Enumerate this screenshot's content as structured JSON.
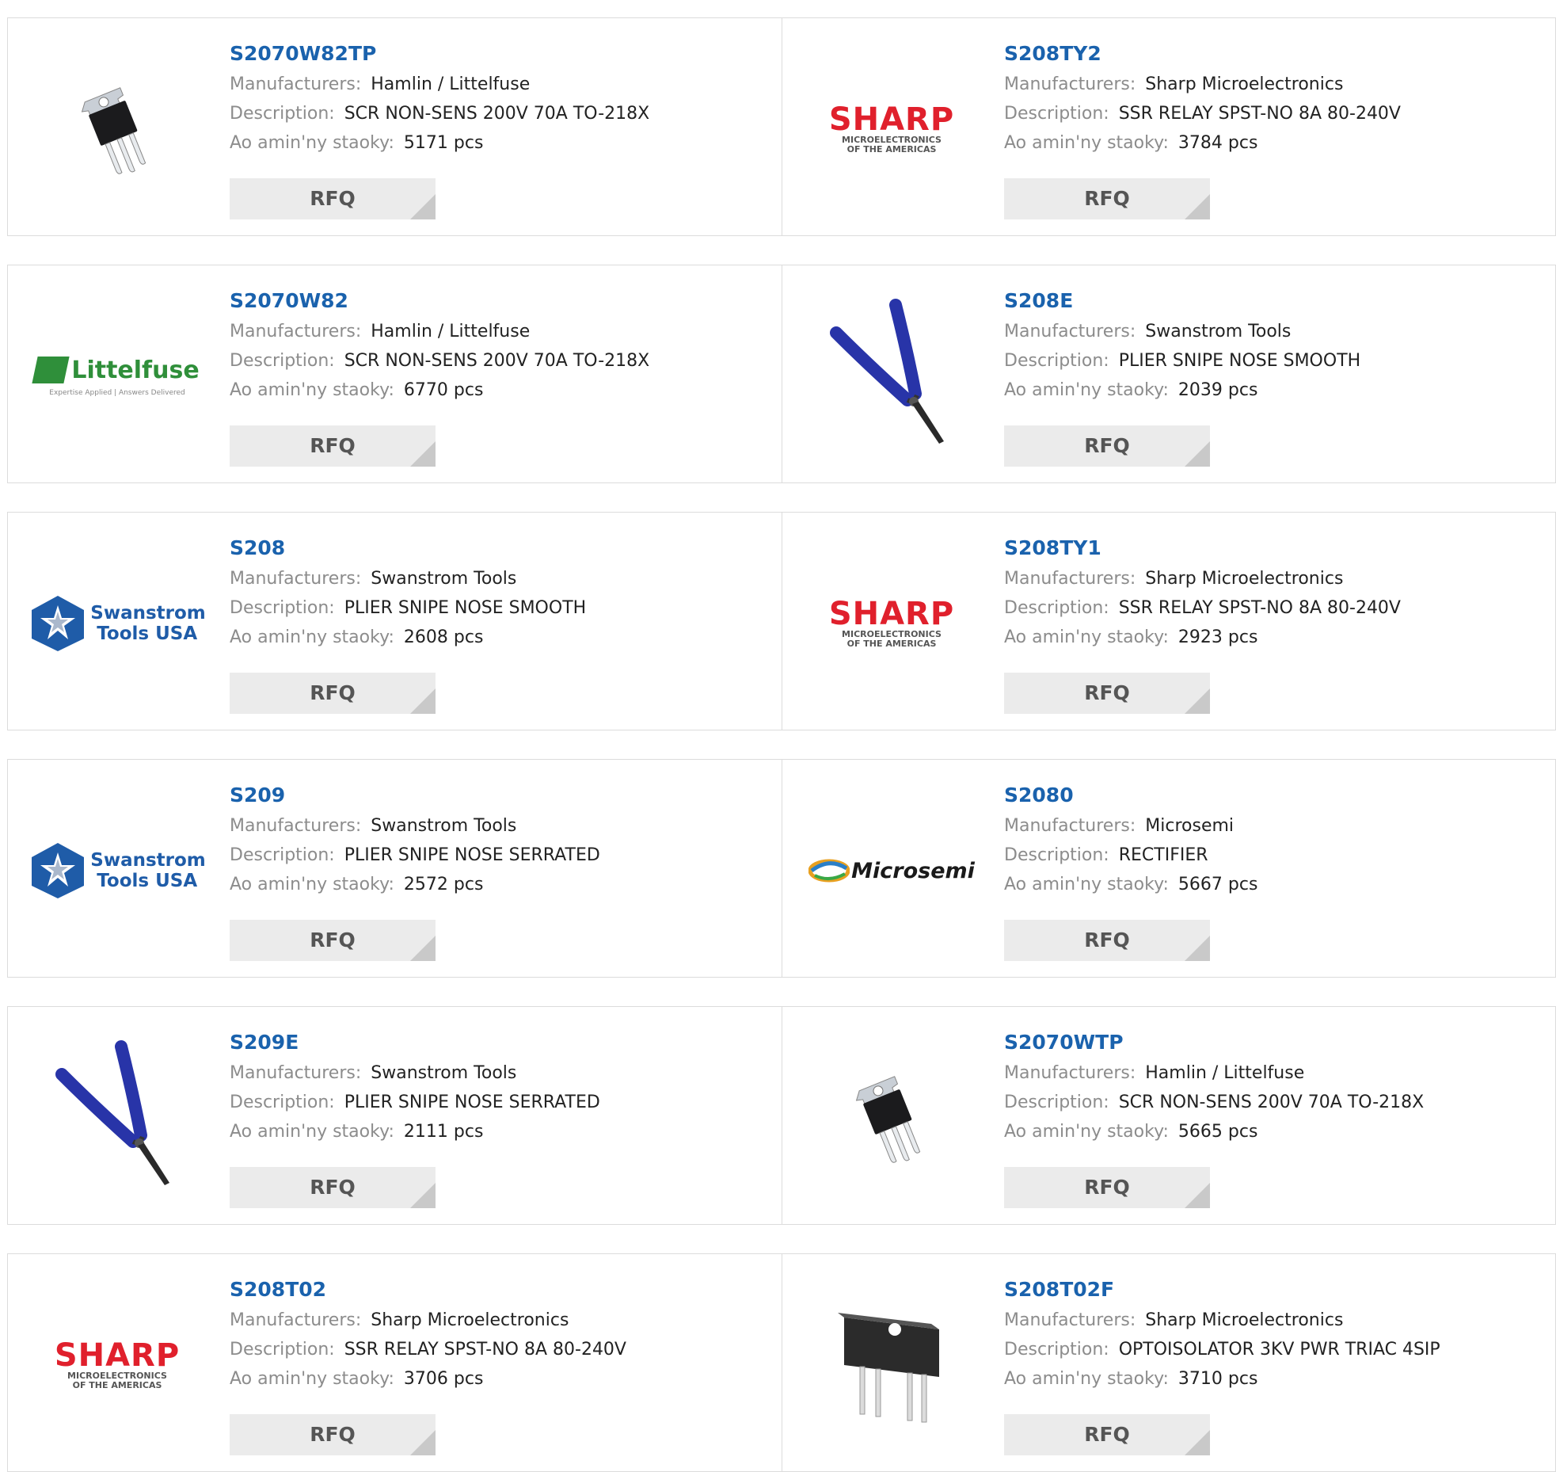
{
  "labels": {
    "manufacturers": "Manufacturers:",
    "description": "Description:",
    "stock": "Ao amin'ny staoky:",
    "rfq": "RFQ"
  },
  "products": [
    {
      "part": "S2070W82TP",
      "manufacturer": "Hamlin / Littelfuse",
      "description": "SCR NON-SENS 200V 70A TO-218X",
      "stock": "5171 pcs",
      "image": "to218-transistor"
    },
    {
      "part": "S208TY2",
      "manufacturer": "Sharp Microelectronics",
      "description": "SSR RELAY SPST-NO 8A 80-240V",
      "stock": "3784 pcs",
      "image": "sharp-logo"
    },
    {
      "part": "S2070W82",
      "manufacturer": "Hamlin / Littelfuse",
      "description": "SCR NON-SENS 200V 70A TO-218X",
      "stock": "6770 pcs",
      "image": "littelfuse-logo"
    },
    {
      "part": "S208E",
      "manufacturer": "Swanstrom Tools",
      "description": "PLIER SNIPE NOSE SMOOTH",
      "stock": "2039 pcs",
      "image": "plier"
    },
    {
      "part": "S208",
      "manufacturer": "Swanstrom Tools",
      "description": "PLIER SNIPE NOSE SMOOTH",
      "stock": "2608 pcs",
      "image": "swanstrom-logo"
    },
    {
      "part": "S208TY1",
      "manufacturer": "Sharp Microelectronics",
      "description": "SSR RELAY SPST-NO 8A 80-240V",
      "stock": "2923 pcs",
      "image": "sharp-logo"
    },
    {
      "part": "S209",
      "manufacturer": "Swanstrom Tools",
      "description": "PLIER SNIPE NOSE SERRATED",
      "stock": "2572 pcs",
      "image": "swanstrom-logo"
    },
    {
      "part": "S2080",
      "manufacturer": "Microsemi",
      "description": "RECTIFIER",
      "stock": "5667 pcs",
      "image": "microsemi-logo"
    },
    {
      "part": "S209E",
      "manufacturer": "Swanstrom Tools",
      "description": "PLIER SNIPE NOSE SERRATED",
      "stock": "2111 pcs",
      "image": "plier"
    },
    {
      "part": "S2070WTP",
      "manufacturer": "Hamlin / Littelfuse",
      "description": "SCR NON-SENS 200V 70A TO-218X",
      "stock": "5665 pcs",
      "image": "to218-transistor"
    },
    {
      "part": "S208T02",
      "manufacturer": "Sharp Microelectronics",
      "description": "SSR RELAY SPST-NO 8A 80-240V",
      "stock": "3706 pcs",
      "image": "sharp-logo"
    },
    {
      "part": "S208T02F",
      "manufacturer": "Sharp Microelectronics",
      "description": "OPTOISOLATOR 3KV PWR TRIAC 4SIP",
      "stock": "3710 pcs",
      "image": "sip-optoisolator"
    }
  ],
  "logos": {
    "sharp": {
      "word": "SHARP",
      "line1": "MICROELECTRONICS",
      "line2": "OF THE AMERICAS"
    },
    "littelfuse": {
      "word": "Littelfuse",
      "tagline": "Expertise Applied | Answers Delivered"
    },
    "swanstrom": {
      "line1": "Swanstrom",
      "line2": "Tools USA"
    },
    "microsemi": {
      "word": "Microsemi"
    }
  },
  "colors": {
    "part_link": "#1a62ad",
    "label": "#8c8c8c",
    "value": "#222222",
    "rfq_bg": "#ebebeb",
    "border": "#dcdcdc",
    "sharp_red": "#e0202c",
    "swanstrom_blue": "#1f5ca8",
    "littelfuse_green": "#2f8f3a",
    "plier_blue": "#2834a8"
  }
}
